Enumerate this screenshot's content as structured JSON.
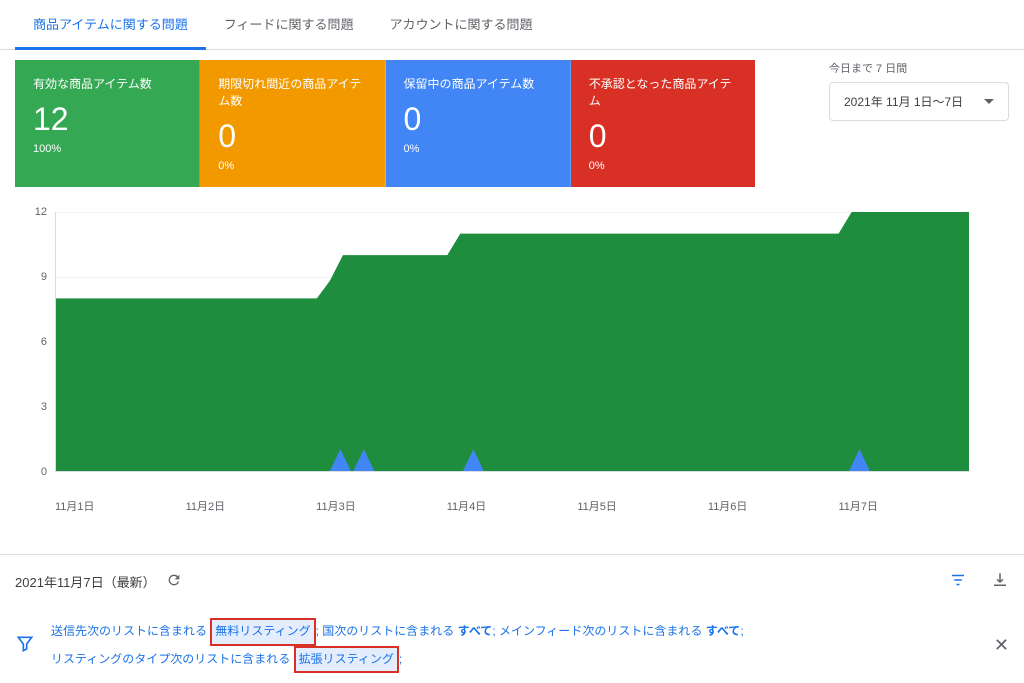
{
  "tabs": [
    {
      "label": "商品アイテムに関する問題",
      "active": true
    },
    {
      "label": "フィードに関する問題",
      "active": false
    },
    {
      "label": "アカウントに関する問題",
      "active": false
    }
  ],
  "cards": [
    {
      "title": "有効な商品アイテム数",
      "value": "12",
      "pct": "100%",
      "color": "green"
    },
    {
      "title": "期限切れ間近の商品アイテム数",
      "value": "0",
      "pct": "0%",
      "color": "orange"
    },
    {
      "title": "保留中の商品アイテム数",
      "value": "0",
      "pct": "0%",
      "color": "blue"
    },
    {
      "title": "不承認となった商品アイテム",
      "value": "0",
      "pct": "0%",
      "color": "red"
    }
  ],
  "date_picker": {
    "label": "今日まで 7 日間",
    "value": "2021年 11月 1日～7日"
  },
  "chart_data": {
    "type": "area",
    "categories": [
      "11月1日",
      "11月2日",
      "11月3日",
      "11月4日",
      "11月5日",
      "11月6日",
      "11月7日"
    ],
    "series": [
      {
        "name": "有効な商品アイテム数",
        "color": "#34a853",
        "values": [
          8,
          8,
          10,
          11,
          11,
          11,
          12
        ]
      },
      {
        "name": "保留中の商品アイテム数",
        "color": "#4285f4",
        "values": [
          0,
          0,
          1,
          1,
          0,
          0,
          1
        ]
      }
    ],
    "ylim": [
      0,
      12
    ],
    "yticks": [
      0,
      3,
      6,
      9,
      12
    ]
  },
  "toolbar": {
    "date": "2021年11月7日（最新）"
  },
  "filter": {
    "line1_a": "送信先次のリストに含まれる",
    "box1": "無料リスティング",
    "line1_b": "; 国次のリストに含まれる ",
    "all1": "すべて",
    "line1_c": "; メインフィード次のリストに含まれる ",
    "all2": "すべて",
    "line1_d": ";",
    "line2_a": "リスティングのタイプ次のリストに含まれる",
    "box2": "拡張リスティング",
    "line2_b": ";"
  }
}
